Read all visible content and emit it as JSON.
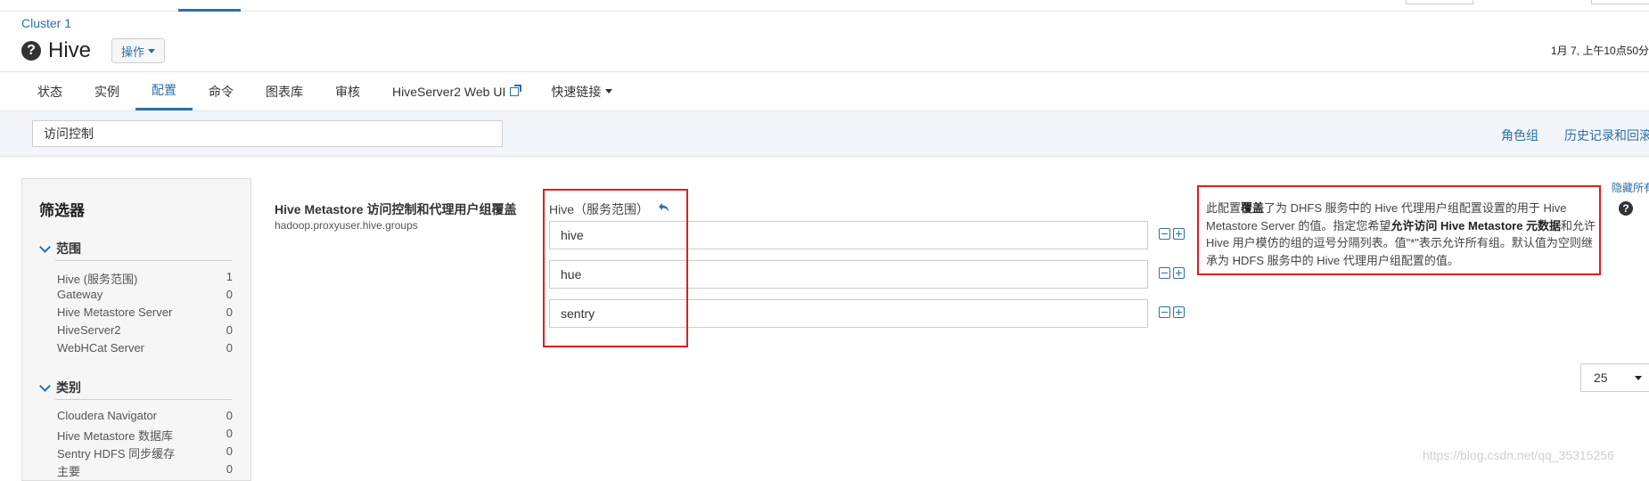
{
  "breadcrumb": {
    "cluster": "Cluster 1"
  },
  "header": {
    "title": "Hive",
    "actions_label": "操作",
    "timestamp": "1月 7, 上午10点50分"
  },
  "tabs": [
    {
      "label": "状态",
      "active": false
    },
    {
      "label": "实例",
      "active": false
    },
    {
      "label": "配置",
      "active": true
    },
    {
      "label": "命令",
      "active": false
    },
    {
      "label": "图表库",
      "active": false
    },
    {
      "label": "审核",
      "active": false
    },
    {
      "label": "HiveServer2 Web UI",
      "active": false
    },
    {
      "label": "快速链接",
      "active": false
    }
  ],
  "search": {
    "value": "访问控制"
  },
  "toolbar_links": {
    "role_groups": "角色组",
    "history": "历史记录和回滚"
  },
  "filters": {
    "title": "筛选器",
    "groups": [
      {
        "label": "范围",
        "items": [
          {
            "label": "Hive (服务范围)",
            "count": "1"
          },
          {
            "label": "Gateway",
            "count": "0"
          },
          {
            "label": "Hive Metastore Server",
            "count": "0"
          },
          {
            "label": "HiveServer2",
            "count": "0"
          },
          {
            "label": "WebHCat Server",
            "count": "0"
          }
        ]
      },
      {
        "label": "类别",
        "items": [
          {
            "label": "Cloudera Navigator",
            "count": "0"
          },
          {
            "label": "Hive Metastore 数据库",
            "count": "0"
          },
          {
            "label": "Sentry HDFS 同步缓存",
            "count": "0"
          },
          {
            "label": "主要",
            "count": "0"
          }
        ]
      }
    ]
  },
  "setting": {
    "name": "Hive Metastore 访问控制和代理用户组覆盖",
    "key": "hadoop.proxyuser.hive.groups",
    "scope_label": "Hive（服务范围）",
    "values": [
      "hive",
      "hue",
      "sentry"
    ],
    "description": {
      "p1": "此配置",
      "b1": "覆盖",
      "p2": "了为 DHFS 服务中的 Hive 代理用户组配置设置的用于 Hive Metastore Server 的值。指定您希望",
      "b2": "允许访问 Hive Metastore 元数据",
      "p3": "和允许 Hive 用户模仿的组的逗号分隔列表。值\"*\"表示允许所有组。默认值为空则继承为 HDFS 服务中的 Hive 代理用户组配置的值。"
    },
    "hide_all_label": "隐藏所有"
  },
  "pagination": {
    "page_size": "25"
  },
  "watermark": "https://blog.csdn.net/qq_35315256",
  "colors": {
    "accent": "#2f6fa7",
    "highlight_box": "#e01e1e"
  }
}
